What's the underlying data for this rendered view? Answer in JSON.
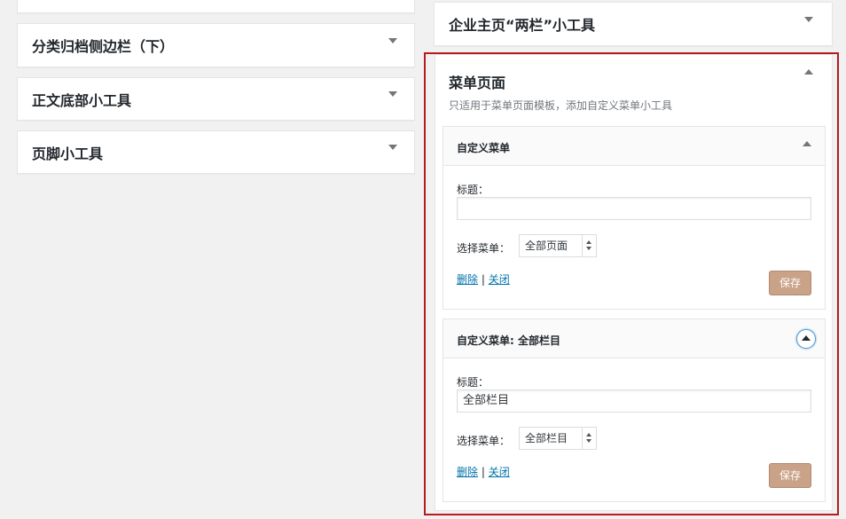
{
  "left_areas": [
    {
      "label": ""
    },
    {
      "label": "分类归档侧边栏（下）"
    },
    {
      "label": "正文底部小工具"
    },
    {
      "label": "页脚小工具"
    }
  ],
  "right_top_area": {
    "label": "企业主页“两栏”小工具"
  },
  "menu_area": {
    "title": "菜单页面",
    "description": "只适用于菜单页面模板，添加自定义菜单小工具",
    "widgets": [
      {
        "title": "自定义菜单",
        "title_label": "标题：",
        "title_value": "",
        "menu_label": "选择菜单：",
        "menu_selected": "全部页面",
        "delete_label": "删除",
        "separator": "|",
        "close_label": "关闭",
        "save_label": "保存"
      },
      {
        "title": "自定义菜单: 全部栏目",
        "title_label": "标题：",
        "title_value": "全部栏目",
        "menu_label": "选择菜单：",
        "menu_selected": "全部栏目",
        "delete_label": "删除",
        "separator": "|",
        "close_label": "关闭",
        "save_label": "保存"
      }
    ]
  },
  "colors": {
    "highlight_border": "#b51b1f",
    "link": "#0073aa",
    "save_button": "#c9a287"
  }
}
